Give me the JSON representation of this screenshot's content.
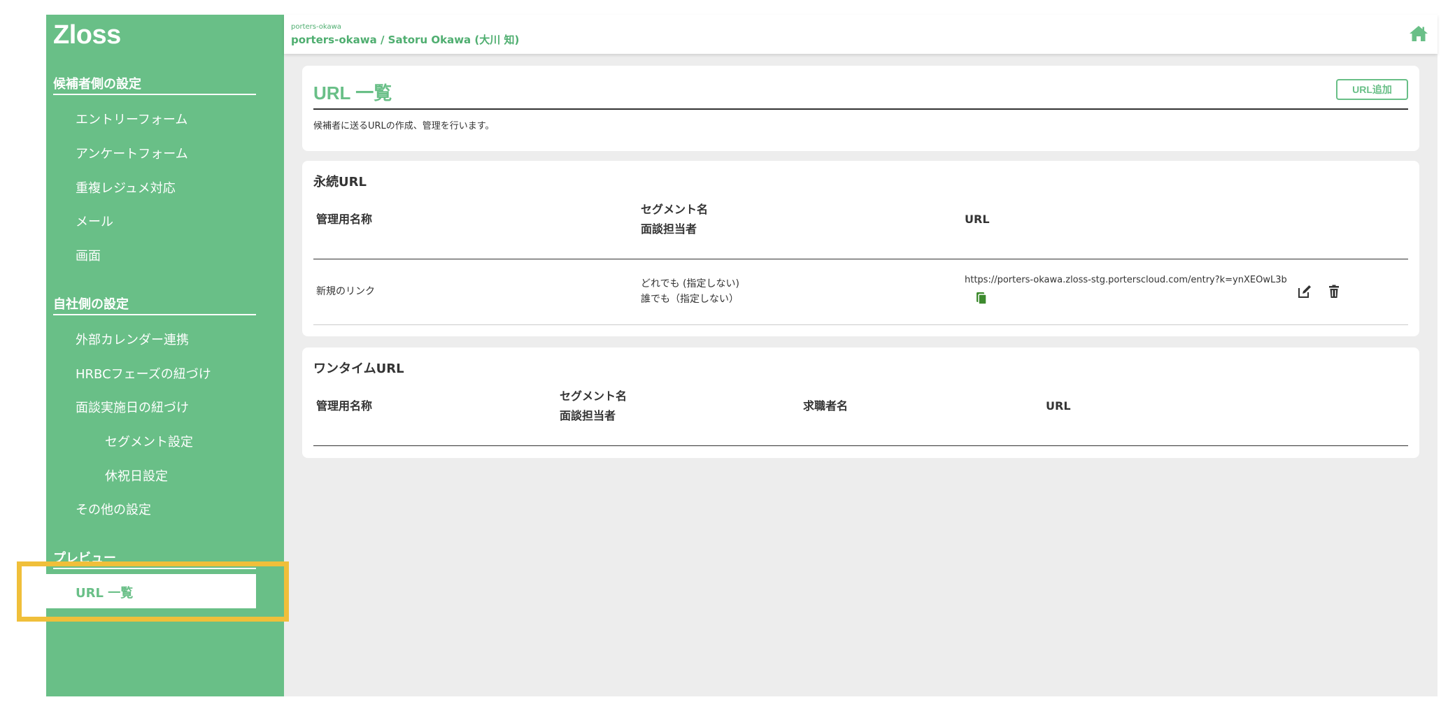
{
  "sidebar": {
    "logo": "Zloss",
    "section1_title": "候補者側の設定",
    "section1_items": [
      "エントリーフォーム",
      "アンケートフォーム",
      "重複レジュメ対応",
      "メール",
      "画面"
    ],
    "section2_title": "自社側の設定",
    "section2_items": [
      "外部カレンダー連携",
      "HRBCフェーズの紐づけ",
      "面談実施日の紐づけ"
    ],
    "section2_subitems": [
      "セグメント設定",
      "休祝日設定"
    ],
    "section2_other": "その他の設定",
    "section3_title": "プレビュー",
    "active_item": "URL 一覧"
  },
  "header": {
    "tenant": "porters-okawa",
    "user": "porters-okawa / Satoru Okawa (大川 知)",
    "home_icon": "home-icon"
  },
  "main": {
    "title": "URL 一覧",
    "add_button": "URL追加",
    "description": "候補者に送るURLの作成、管理を行います。"
  },
  "permanent": {
    "title": "永続URL",
    "headers": {
      "name": "管理用名称",
      "segment": "セグメント名",
      "interviewer": "面談担当者",
      "url": "URL"
    },
    "rows": [
      {
        "name": "新規のリンク",
        "segment": "どれでも (指定しない)",
        "interviewer": "誰でも（指定しない）",
        "url": "https://porters-okawa.zloss-stg.porterscloud.com/entry?k=ynXEOwL3b"
      }
    ]
  },
  "onetime": {
    "title": "ワンタイムURL",
    "headers": {
      "name": "管理用名称",
      "segment": "セグメント名",
      "interviewer": "面談担当者",
      "applicant": "求職者名",
      "url": "URL"
    }
  },
  "colors": {
    "accent": "#69bf87",
    "highlight": "#f0bf3a",
    "copy_icon": "#3d8a2e"
  }
}
